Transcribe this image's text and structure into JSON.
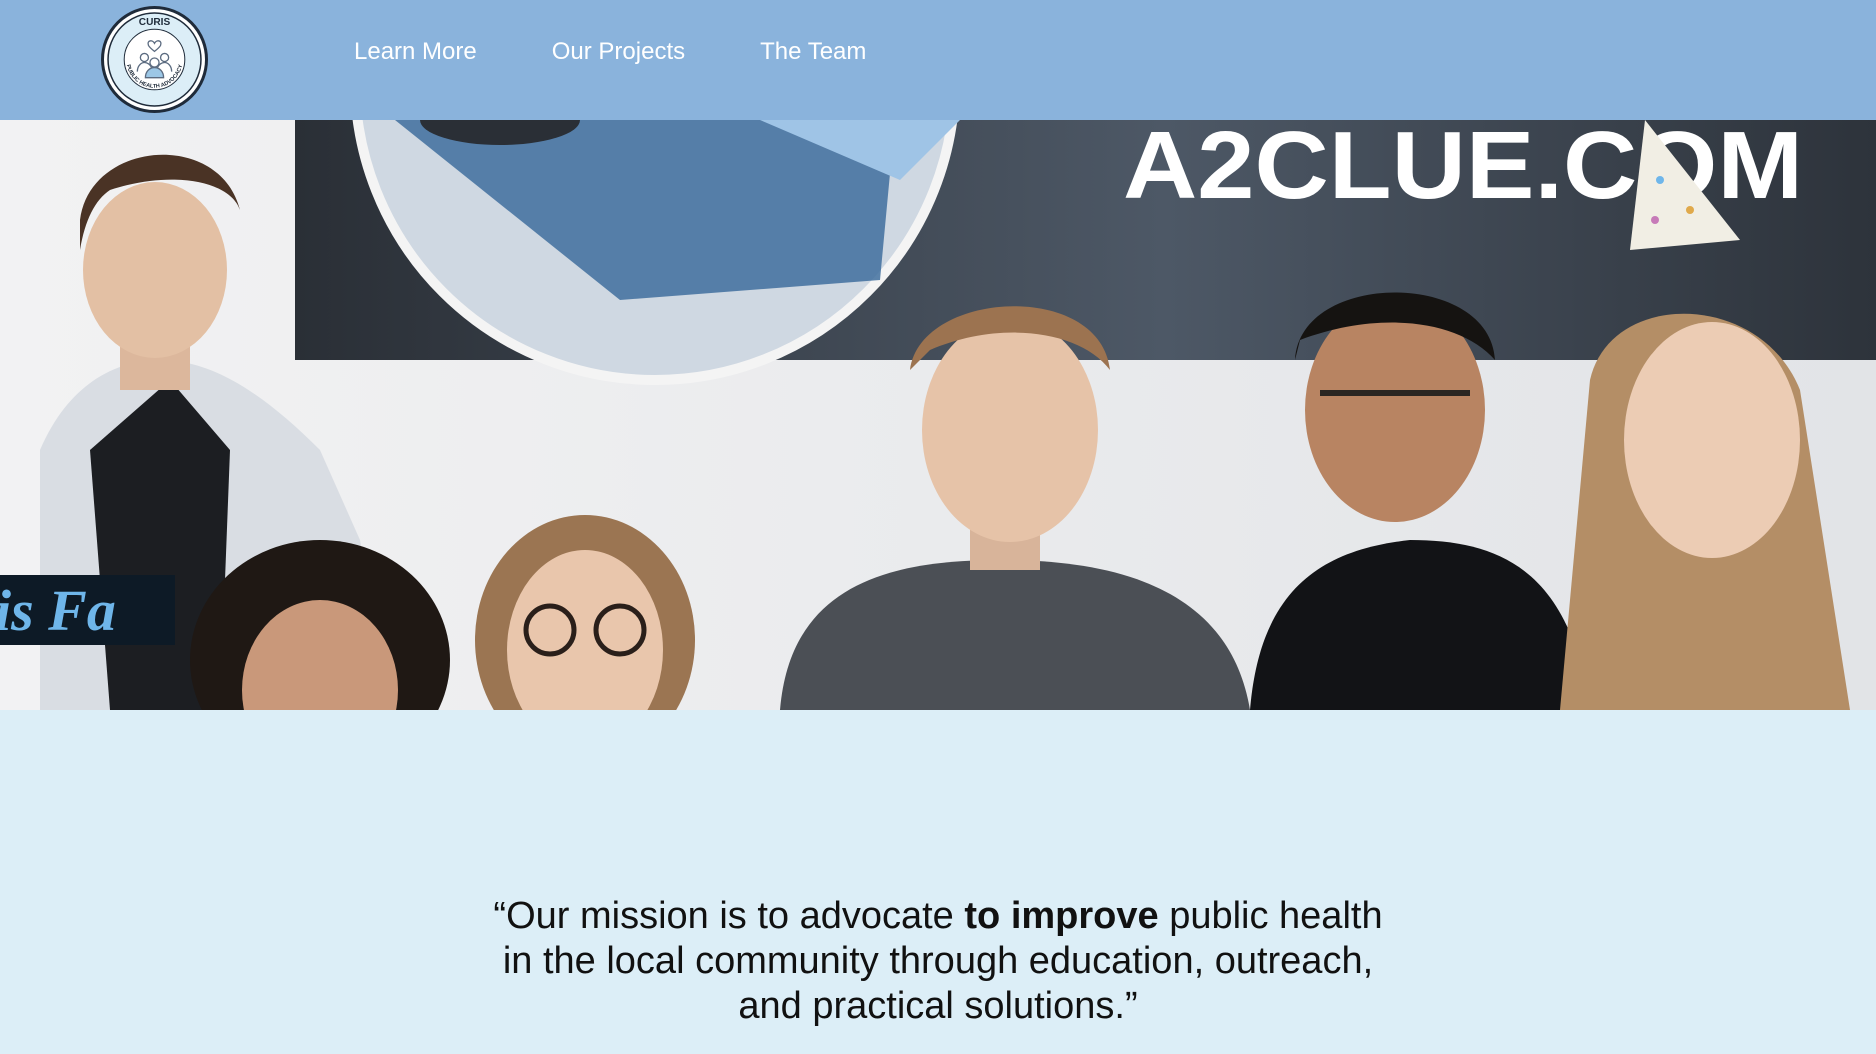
{
  "header": {
    "logo": {
      "top_text": "CURIS",
      "ring_text": "PUBLIC HEALTH ADVOCACY",
      "icon": "people-heart-icon"
    },
    "nav": [
      {
        "label": "Learn More"
      },
      {
        "label": "Our Projects"
      },
      {
        "label": "The Team"
      }
    ],
    "background_color": "#8ab3dc"
  },
  "hero": {
    "banner_text": "A2CLUE.COM",
    "sign_text": "is Fa"
  },
  "mission": {
    "line1_prefix": "“Our mission is to advocate ",
    "line1_bold": "to improve",
    "line1_suffix": " public health",
    "line2": "in the local community through education, outreach,",
    "line3": "and practical solutions.”"
  },
  "page": {
    "background_color": "#dceef7"
  }
}
